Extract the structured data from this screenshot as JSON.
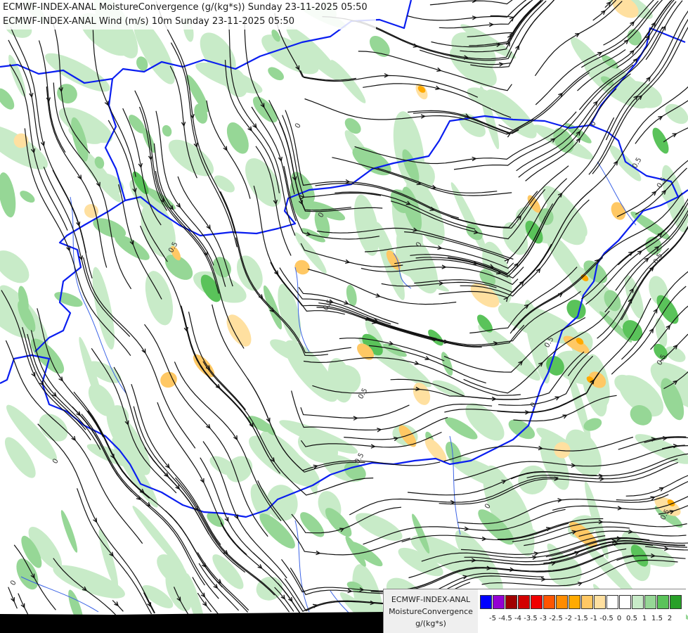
{
  "title_lines": [
    "ECMWF-INDEX-ANAL MoistureConvergence (g/(kg*s)) Sunday 23-11-2025 05:50",
    "ECMWF-INDEX-ANAL Wind (m/s) 10m Sunday 23-11-2025 05:50"
  ],
  "legend": {
    "title_line1": "ECMWF-INDEX-ANAL",
    "title_line2": "MoistureConvergence",
    "units": "g/(kg*s)",
    "colors": [
      "#0000ff",
      "#9400d3",
      "#a00000",
      "#d20000",
      "#f00000",
      "#ff5500",
      "#ff8c00",
      "#ffaa00",
      "#ffc864",
      "#ffe0a0",
      "#ffffff",
      "#ffffff",
      "#c8ebc8",
      "#96d796",
      "#5ac35a",
      "#28a028"
    ],
    "tick_labels": [
      "-5",
      "-4.5",
      "-4",
      "-3.5",
      "-3",
      "-2.5",
      "-2",
      "-1.5",
      "-1",
      "-0.5",
      "0",
      "0.5",
      "1",
      "1.5",
      "2"
    ]
  },
  "map_labels": [
    "0",
    "0",
    "0",
    "0",
    "0",
    "0",
    "0",
    "0.5",
    "0.5",
    "0.5",
    "0.5",
    "0.5",
    "0.5",
    "0.5",
    "0.5",
    "0.5",
    "0.5",
    "0"
  ],
  "field_colors": {
    "light_green": "#c8ebc8",
    "mid_green": "#96d796",
    "dark_green": "#5ac35a",
    "light_orange": "#ffe0a0",
    "orange": "#ffc864",
    "deep_orange": "#ffaa00",
    "border_blue": "#0a1ef0",
    "river_blue": "#3c64e6",
    "streamline": "#101010",
    "dark_strip": "#000000"
  }
}
